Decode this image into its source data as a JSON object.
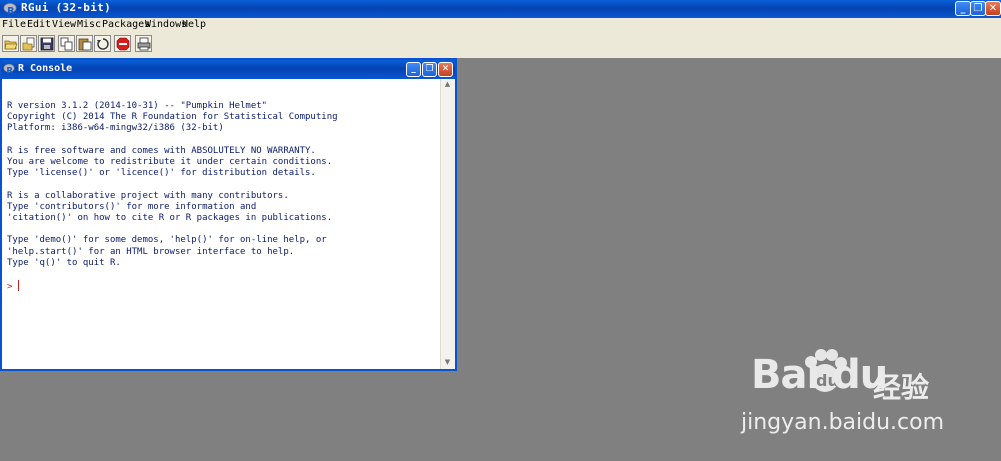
{
  "app": {
    "title": "RGui (32-bit)",
    "window_buttons": {
      "minimize": "_",
      "restore": "❐",
      "close": "✕"
    }
  },
  "menubar": {
    "items": [
      "File",
      "Edit",
      "View",
      "Misc",
      "Packages",
      "Windows",
      "Help"
    ]
  },
  "toolbar": {
    "buttons": [
      "open-script-icon",
      "load-workspace-icon",
      "save-icon",
      "copy-icon",
      "paste-icon",
      "copy-paste-icon",
      "stop-icon",
      "print-icon"
    ]
  },
  "console": {
    "title": "R Console",
    "lines": [
      "R version 3.1.2 (2014-10-31) -- \"Pumpkin Helmet\"",
      "Copyright (C) 2014 The R Foundation for Statistical Computing",
      "Platform: i386-w64-mingw32/i386 (32-bit)",
      "",
      "R is free software and comes with ABSOLUTELY NO WARRANTY.",
      "You are welcome to redistribute it under certain conditions.",
      "Type 'license()' or 'licence()' for distribution details.",
      "",
      "R is a collaborative project with many contributors.",
      "Type 'contributors()' for more information and",
      "'citation()' on how to cite R or R packages in publications.",
      "",
      "Type 'demo()' for some demos, 'help()' for on-line help, or",
      "'help.start()' for an HTML browser interface to help.",
      "Type 'q()' to quit R."
    ],
    "prompt": ">"
  },
  "watermark": {
    "logo": "Bai du",
    "cn": "经验",
    "url": "jingyan.baidu.com"
  },
  "colors": {
    "titlebar": "#0a53cf",
    "console_text": "#0a1b6e",
    "prompt": "#c81e1e",
    "workspace": "#808080"
  }
}
